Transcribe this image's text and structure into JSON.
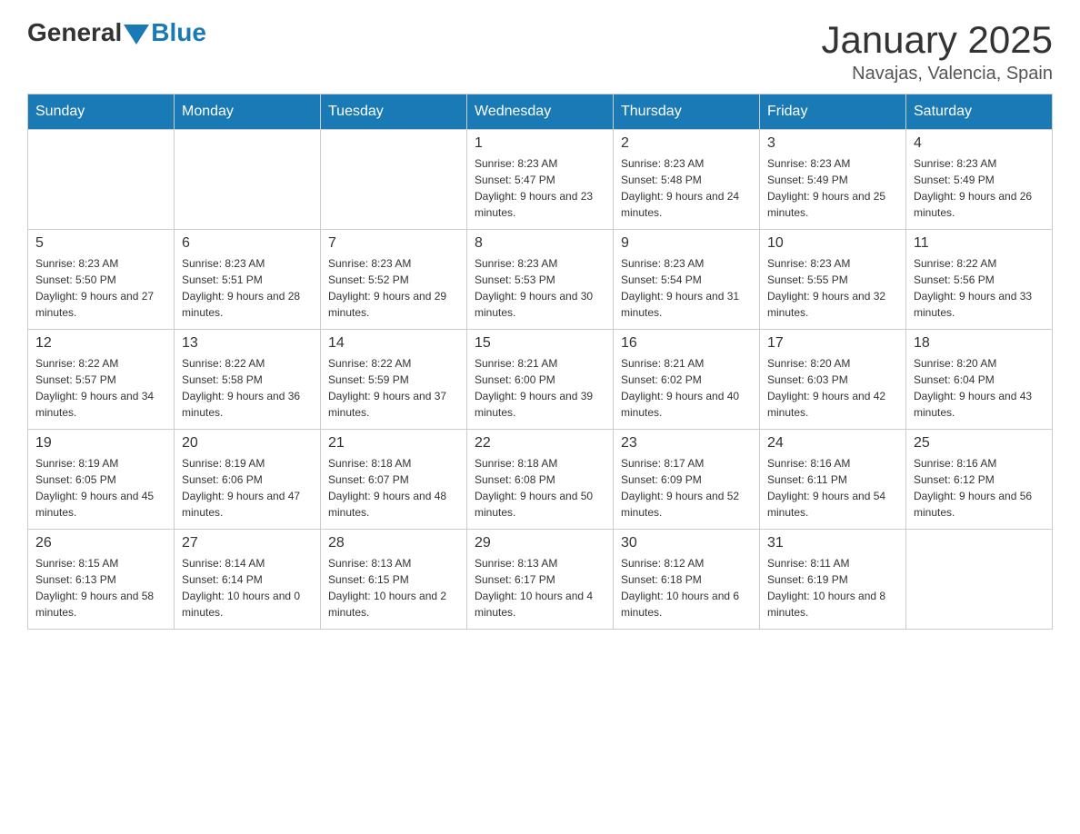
{
  "header": {
    "logo_general": "General",
    "logo_blue": "Blue",
    "month_year": "January 2025",
    "location": "Navajas, Valencia, Spain"
  },
  "days_of_week": [
    "Sunday",
    "Monday",
    "Tuesday",
    "Wednesday",
    "Thursday",
    "Friday",
    "Saturday"
  ],
  "weeks": [
    [
      {
        "day": "",
        "sunrise": "",
        "sunset": "",
        "daylight": ""
      },
      {
        "day": "",
        "sunrise": "",
        "sunset": "",
        "daylight": ""
      },
      {
        "day": "",
        "sunrise": "",
        "sunset": "",
        "daylight": ""
      },
      {
        "day": "1",
        "sunrise": "Sunrise: 8:23 AM",
        "sunset": "Sunset: 5:47 PM",
        "daylight": "Daylight: 9 hours and 23 minutes."
      },
      {
        "day": "2",
        "sunrise": "Sunrise: 8:23 AM",
        "sunset": "Sunset: 5:48 PM",
        "daylight": "Daylight: 9 hours and 24 minutes."
      },
      {
        "day": "3",
        "sunrise": "Sunrise: 8:23 AM",
        "sunset": "Sunset: 5:49 PM",
        "daylight": "Daylight: 9 hours and 25 minutes."
      },
      {
        "day": "4",
        "sunrise": "Sunrise: 8:23 AM",
        "sunset": "Sunset: 5:49 PM",
        "daylight": "Daylight: 9 hours and 26 minutes."
      }
    ],
    [
      {
        "day": "5",
        "sunrise": "Sunrise: 8:23 AM",
        "sunset": "Sunset: 5:50 PM",
        "daylight": "Daylight: 9 hours and 27 minutes."
      },
      {
        "day": "6",
        "sunrise": "Sunrise: 8:23 AM",
        "sunset": "Sunset: 5:51 PM",
        "daylight": "Daylight: 9 hours and 28 minutes."
      },
      {
        "day": "7",
        "sunrise": "Sunrise: 8:23 AM",
        "sunset": "Sunset: 5:52 PM",
        "daylight": "Daylight: 9 hours and 29 minutes."
      },
      {
        "day": "8",
        "sunrise": "Sunrise: 8:23 AM",
        "sunset": "Sunset: 5:53 PM",
        "daylight": "Daylight: 9 hours and 30 minutes."
      },
      {
        "day": "9",
        "sunrise": "Sunrise: 8:23 AM",
        "sunset": "Sunset: 5:54 PM",
        "daylight": "Daylight: 9 hours and 31 minutes."
      },
      {
        "day": "10",
        "sunrise": "Sunrise: 8:23 AM",
        "sunset": "Sunset: 5:55 PM",
        "daylight": "Daylight: 9 hours and 32 minutes."
      },
      {
        "day": "11",
        "sunrise": "Sunrise: 8:22 AM",
        "sunset": "Sunset: 5:56 PM",
        "daylight": "Daylight: 9 hours and 33 minutes."
      }
    ],
    [
      {
        "day": "12",
        "sunrise": "Sunrise: 8:22 AM",
        "sunset": "Sunset: 5:57 PM",
        "daylight": "Daylight: 9 hours and 34 minutes."
      },
      {
        "day": "13",
        "sunrise": "Sunrise: 8:22 AM",
        "sunset": "Sunset: 5:58 PM",
        "daylight": "Daylight: 9 hours and 36 minutes."
      },
      {
        "day": "14",
        "sunrise": "Sunrise: 8:22 AM",
        "sunset": "Sunset: 5:59 PM",
        "daylight": "Daylight: 9 hours and 37 minutes."
      },
      {
        "day": "15",
        "sunrise": "Sunrise: 8:21 AM",
        "sunset": "Sunset: 6:00 PM",
        "daylight": "Daylight: 9 hours and 39 minutes."
      },
      {
        "day": "16",
        "sunrise": "Sunrise: 8:21 AM",
        "sunset": "Sunset: 6:02 PM",
        "daylight": "Daylight: 9 hours and 40 minutes."
      },
      {
        "day": "17",
        "sunrise": "Sunrise: 8:20 AM",
        "sunset": "Sunset: 6:03 PM",
        "daylight": "Daylight: 9 hours and 42 minutes."
      },
      {
        "day": "18",
        "sunrise": "Sunrise: 8:20 AM",
        "sunset": "Sunset: 6:04 PM",
        "daylight": "Daylight: 9 hours and 43 minutes."
      }
    ],
    [
      {
        "day": "19",
        "sunrise": "Sunrise: 8:19 AM",
        "sunset": "Sunset: 6:05 PM",
        "daylight": "Daylight: 9 hours and 45 minutes."
      },
      {
        "day": "20",
        "sunrise": "Sunrise: 8:19 AM",
        "sunset": "Sunset: 6:06 PM",
        "daylight": "Daylight: 9 hours and 47 minutes."
      },
      {
        "day": "21",
        "sunrise": "Sunrise: 8:18 AM",
        "sunset": "Sunset: 6:07 PM",
        "daylight": "Daylight: 9 hours and 48 minutes."
      },
      {
        "day": "22",
        "sunrise": "Sunrise: 8:18 AM",
        "sunset": "Sunset: 6:08 PM",
        "daylight": "Daylight: 9 hours and 50 minutes."
      },
      {
        "day": "23",
        "sunrise": "Sunrise: 8:17 AM",
        "sunset": "Sunset: 6:09 PM",
        "daylight": "Daylight: 9 hours and 52 minutes."
      },
      {
        "day": "24",
        "sunrise": "Sunrise: 8:16 AM",
        "sunset": "Sunset: 6:11 PM",
        "daylight": "Daylight: 9 hours and 54 minutes."
      },
      {
        "day": "25",
        "sunrise": "Sunrise: 8:16 AM",
        "sunset": "Sunset: 6:12 PM",
        "daylight": "Daylight: 9 hours and 56 minutes."
      }
    ],
    [
      {
        "day": "26",
        "sunrise": "Sunrise: 8:15 AM",
        "sunset": "Sunset: 6:13 PM",
        "daylight": "Daylight: 9 hours and 58 minutes."
      },
      {
        "day": "27",
        "sunrise": "Sunrise: 8:14 AM",
        "sunset": "Sunset: 6:14 PM",
        "daylight": "Daylight: 10 hours and 0 minutes."
      },
      {
        "day": "28",
        "sunrise": "Sunrise: 8:13 AM",
        "sunset": "Sunset: 6:15 PM",
        "daylight": "Daylight: 10 hours and 2 minutes."
      },
      {
        "day": "29",
        "sunrise": "Sunrise: 8:13 AM",
        "sunset": "Sunset: 6:17 PM",
        "daylight": "Daylight: 10 hours and 4 minutes."
      },
      {
        "day": "30",
        "sunrise": "Sunrise: 8:12 AM",
        "sunset": "Sunset: 6:18 PM",
        "daylight": "Daylight: 10 hours and 6 minutes."
      },
      {
        "day": "31",
        "sunrise": "Sunrise: 8:11 AM",
        "sunset": "Sunset: 6:19 PM",
        "daylight": "Daylight: 10 hours and 8 minutes."
      },
      {
        "day": "",
        "sunrise": "",
        "sunset": "",
        "daylight": ""
      }
    ]
  ]
}
